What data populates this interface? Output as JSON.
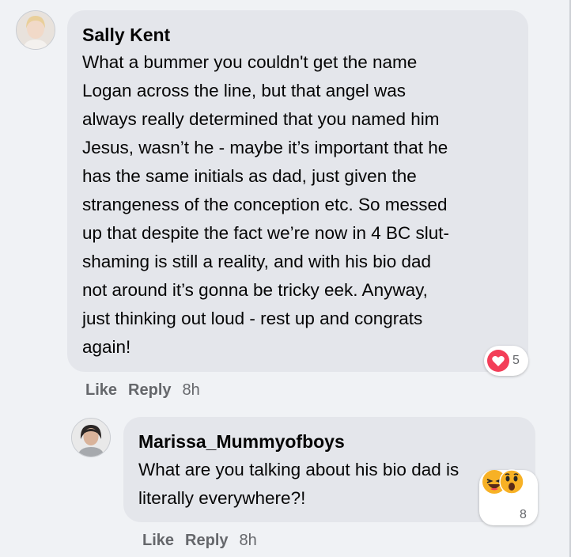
{
  "comment": {
    "author": "Sally Kent",
    "lines": [
      "What a bummer you couldn't get the name",
      "Logan across the line, but that angel was",
      "always really determined that you named him",
      "Jesus, wasn’t he - maybe it’s important that he",
      "has the same initials as dad, just given the",
      "strangeness of the conception etc. So messed",
      "up that despite the fact we’re now in 4 BC slut-",
      "shaming is still a reality, and with his bio dad",
      "not around it’s gonna be tricky eek. Anyway,",
      "just thinking out loud - rest up and congrats",
      "again!"
    ],
    "reaction_count": "5",
    "like_label": "Like",
    "reply_label": "Reply",
    "time": "8h"
  },
  "reply": {
    "author": "Marissa_Mummyofboys",
    "lines": [
      "What are you talking about his bio dad is",
      "literally everywhere?!"
    ],
    "reaction_count": "8",
    "like_label": "Like",
    "reply_label": "Reply",
    "time": "8h"
  },
  "colors": {
    "background": "#f0f2f5",
    "bubble": "#e4e6eb",
    "meta_text": "#65676b",
    "love_reaction": "#f33e58",
    "haha_reaction": "#f7b125"
  },
  "icons": {
    "comment_reaction": "love-heart-icon",
    "reply_reactions": [
      "haha-icon",
      "wow-icon"
    ]
  }
}
